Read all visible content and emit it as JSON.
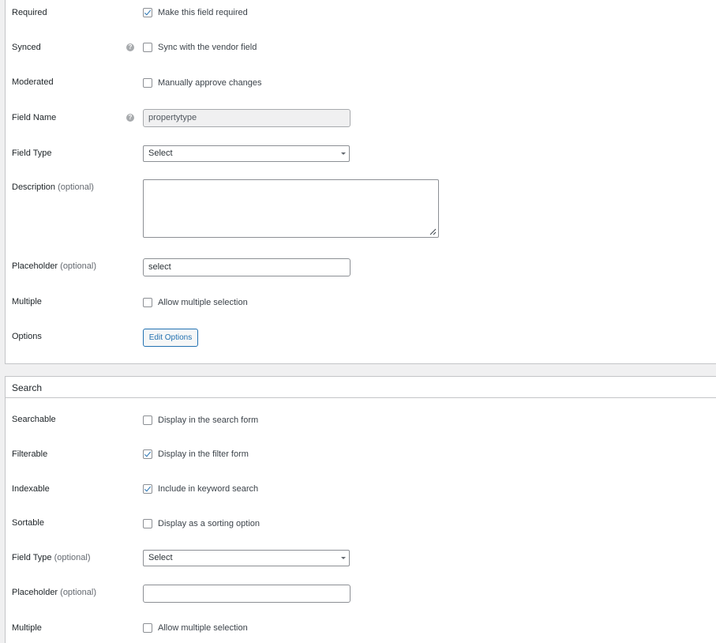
{
  "general": {
    "required": {
      "label": "Required",
      "checkbox_label": "Make this field required",
      "checked": true
    },
    "synced": {
      "label": "Synced",
      "checkbox_label": "Sync with the vendor field",
      "checked": false,
      "help_icon": "?"
    },
    "moderated": {
      "label": "Moderated",
      "checkbox_label": "Manually approve changes",
      "checked": false
    },
    "field_name": {
      "label": "Field Name",
      "value": "propertytype",
      "help_icon": "?"
    },
    "field_type": {
      "label": "Field Type",
      "value": "Select"
    },
    "description": {
      "label": "Description",
      "optional": "(optional)",
      "value": ""
    },
    "placeholder": {
      "label": "Placeholder",
      "optional": "(optional)",
      "value": "select"
    },
    "multiple": {
      "label": "Multiple",
      "checkbox_label": "Allow multiple selection",
      "checked": false
    },
    "options": {
      "label": "Options",
      "button_label": "Edit Options"
    }
  },
  "search": {
    "title": "Search",
    "searchable": {
      "label": "Searchable",
      "checkbox_label": "Display in the search form",
      "checked": false
    },
    "filterable": {
      "label": "Filterable",
      "checkbox_label": "Display in the filter form",
      "checked": true
    },
    "indexable": {
      "label": "Indexable",
      "checkbox_label": "Include in keyword search",
      "checked": true
    },
    "sortable": {
      "label": "Sortable",
      "checkbox_label": "Display as a sorting option",
      "checked": false
    },
    "field_type": {
      "label": "Field Type",
      "optional": "(optional)",
      "value": "Select"
    },
    "placeholder": {
      "label": "Placeholder",
      "optional": "(optional)",
      "value": ""
    },
    "multiple": {
      "label": "Multiple",
      "checkbox_label": "Allow multiple selection",
      "checked": false
    }
  },
  "colors": {
    "accent": "#2271b1",
    "border": "#8c8f94",
    "background": "#f0f0f1"
  }
}
